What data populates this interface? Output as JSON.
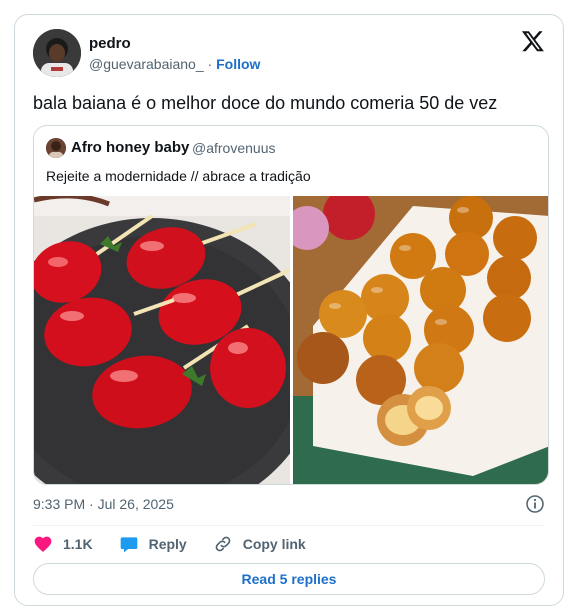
{
  "tweet": {
    "author_name": "pedro",
    "author_handle": "@guevarabaiano_",
    "separator": "·",
    "follow_label": "Follow",
    "text": "bala baiana é o melhor doce do mundo comeria 50 de vez",
    "timestamp": "9:33 PM · Jul 26, 2025"
  },
  "quote": {
    "author_name": "Afro honey baby",
    "author_handle": "@afrovenuus",
    "text": "Rejeite a modernidade // abrace a tradição"
  },
  "actions": {
    "likes": "1.1K",
    "reply_label": "Reply",
    "copy_label": "Copy link",
    "read_replies_label": "Read 5 replies"
  },
  "colors": {
    "accent": "#1d6fc9",
    "like": "#f91880",
    "reply": "#1d9bf0",
    "text_secondary": "#536471",
    "border": "#cfd9de"
  },
  "icons": {
    "platform": "x-logo-icon",
    "info": "info-icon",
    "like": "heart-icon",
    "reply": "speech-bubble-icon",
    "copy": "link-icon"
  }
}
